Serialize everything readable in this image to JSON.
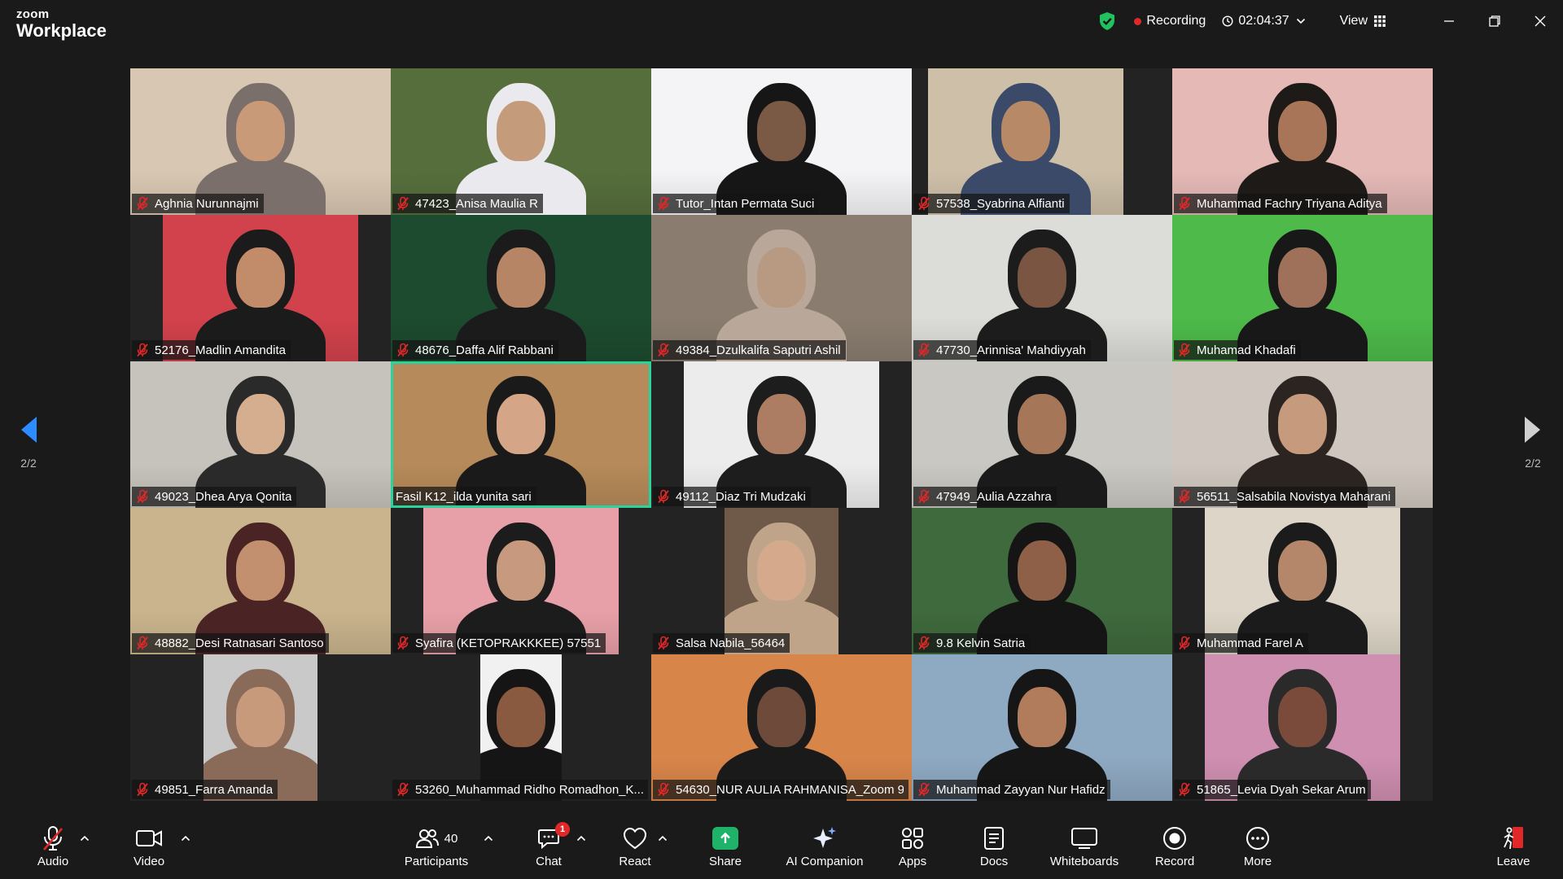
{
  "titlebar": {
    "logo_top": "zoom",
    "logo_bottom": "Workplace",
    "recording_label": "Recording",
    "timer": "02:04:37",
    "view_label": "View"
  },
  "pager": {
    "left_page": "2/2",
    "right_page": "2/2"
  },
  "participants": [
    {
      "name": "Aghnia Nurunnajmi",
      "bg": "#d8c7b2",
      "skin": "#c99a78",
      "hijab": "#7a6f6a",
      "muted": true
    },
    {
      "name": "47423_Anisa Maulia R",
      "bg": "#566e3c",
      "skin": "#c49c7c",
      "hijab": "#e9e9ee",
      "muted": true
    },
    {
      "name": "Tutor_Intan Permata Suci",
      "bg": "#f4f4f6",
      "skin": "#7a5a45",
      "hijab": "#161616",
      "muted": true
    },
    {
      "name": "57538_Syabrina Alfianti",
      "bg": "#cdbfa8",
      "skin": "#b88966",
      "hijab": "#3a4a68",
      "muted": true
    },
    {
      "name": "Muhammad Fachry Triyana Aditya",
      "bg": "#e4b9b6",
      "skin": "#a87558",
      "hijab": "#1e1a18",
      "muted": true
    },
    {
      "name": "52176_Madlin Amandita",
      "bg": "#d2424c",
      "skin": "#c28c6a",
      "hijab": "#1b1b1b",
      "muted": true
    },
    {
      "name": "48676_Daffa Alif Rabbani",
      "bg": "#1d4b2f",
      "skin": "#b68566",
      "hijab": "#1b1b1b",
      "muted": true
    },
    {
      "name": "49384_Dzulkalifa Saputri Ashil",
      "bg": "#8a7d70",
      "skin": "#b89a82",
      "hijab": "#b9a899",
      "muted": true
    },
    {
      "name": "47730_Arinnisa' Mahdiyyah",
      "bg": "#dcdcd8",
      "skin": "#7a5542",
      "hijab": "#1c1c1c",
      "muted": true
    },
    {
      "name": "Muhamad Khadafi",
      "bg": "#4dba4a",
      "skin": "#a0715a",
      "hijab": "#181818",
      "muted": true
    },
    {
      "name": "49023_Dhea Arya Qonita",
      "bg": "#c6c3bc",
      "skin": "#d5ad8f",
      "hijab": "#2a2a2a",
      "muted": true
    },
    {
      "name": "Fasil K12_ilda yunita sari",
      "bg": "#b68a5a",
      "skin": "#d4a586",
      "hijab": "#1a1a1a",
      "muted": false
    },
    {
      "name": "49112_Diaz Tri Mudzaki",
      "bg": "#ececec",
      "skin": "#ad7d63",
      "hijab": "#1d1d1d",
      "muted": true
    },
    {
      "name": "47949_Aulia Azzahra",
      "bg": "#c9c8c2",
      "skin": "#a57657",
      "hijab": "#1a1a1a",
      "muted": true
    },
    {
      "name": "56511_Salsabila Novistya Maharani",
      "bg": "#cfc7bf",
      "skin": "#c69a7d",
      "hijab": "#2b2420",
      "muted": true
    },
    {
      "name": "48882_Desi Ratnasari Santoso",
      "bg": "#c9b48d",
      "skin": "#c2906f",
      "hijab": "#4a2324",
      "muted": true
    },
    {
      "name": "Syafira (KETOPRAKKKEE) 57551",
      "bg": "#e8a0a8",
      "skin": "#c79a80",
      "hijab": "#1c1c1c",
      "muted": true
    },
    {
      "name": "Salsa Nabila_56464",
      "bg": "#6f5a4a",
      "skin": "#d4a98c",
      "hijab": "#c0a48a",
      "muted": true
    },
    {
      "name": "9.8 Kelvin Satria",
      "bg": "#3f6a3d",
      "skin": "#8e6048",
      "hijab": "#151515",
      "muted": true
    },
    {
      "name": "Muhammad Farel A",
      "bg": "#ddd6c8",
      "skin": "#b5876a",
      "hijab": "#1b1b1b",
      "muted": true
    },
    {
      "name": "49851_Farra Amanda",
      "bg": "#c9c9c9",
      "skin": "#c89a7c",
      "hijab": "#8a6a58",
      "muted": true
    },
    {
      "name": "53260_Muhammad Ridho Romadhon_K...",
      "bg": "#f1f1f1",
      "skin": "#8a5a40",
      "hijab": "#151515",
      "muted": true
    },
    {
      "name": "54630_NUR AULIA RAHMANISA_Zoom 9",
      "bg": "#d8854a",
      "skin": "#6e4a3a",
      "hijab": "#1a1a1a",
      "muted": true
    },
    {
      "name": "Muhammad Zayyan Nur Hafidz",
      "bg": "#8ea9c2",
      "skin": "#b07c5c",
      "hijab": "#161616",
      "muted": true
    },
    {
      "name": "51865_Levia Dyah Sekar Arum",
      "bg": "#cf8fb0",
      "skin": "#7a4a3a",
      "hijab": "#2a2a2a",
      "muted": true
    }
  ],
  "toolbar": {
    "audio": "Audio",
    "video": "Video",
    "participants": "Participants",
    "participants_count": "40",
    "chat": "Chat",
    "chat_badge": "1",
    "react": "React",
    "share": "Share",
    "ai_companion": "AI Companion",
    "apps": "Apps",
    "docs": "Docs",
    "whiteboards": "Whiteboards",
    "record": "Record",
    "more": "More",
    "leave": "Leave"
  },
  "colors": {
    "background": "#1a1a1a",
    "active_speaker_border": "#29d39c",
    "recording_dot": "#e02828",
    "share_green": "#1fb36a",
    "pager_arrow": "#2d8cff"
  }
}
